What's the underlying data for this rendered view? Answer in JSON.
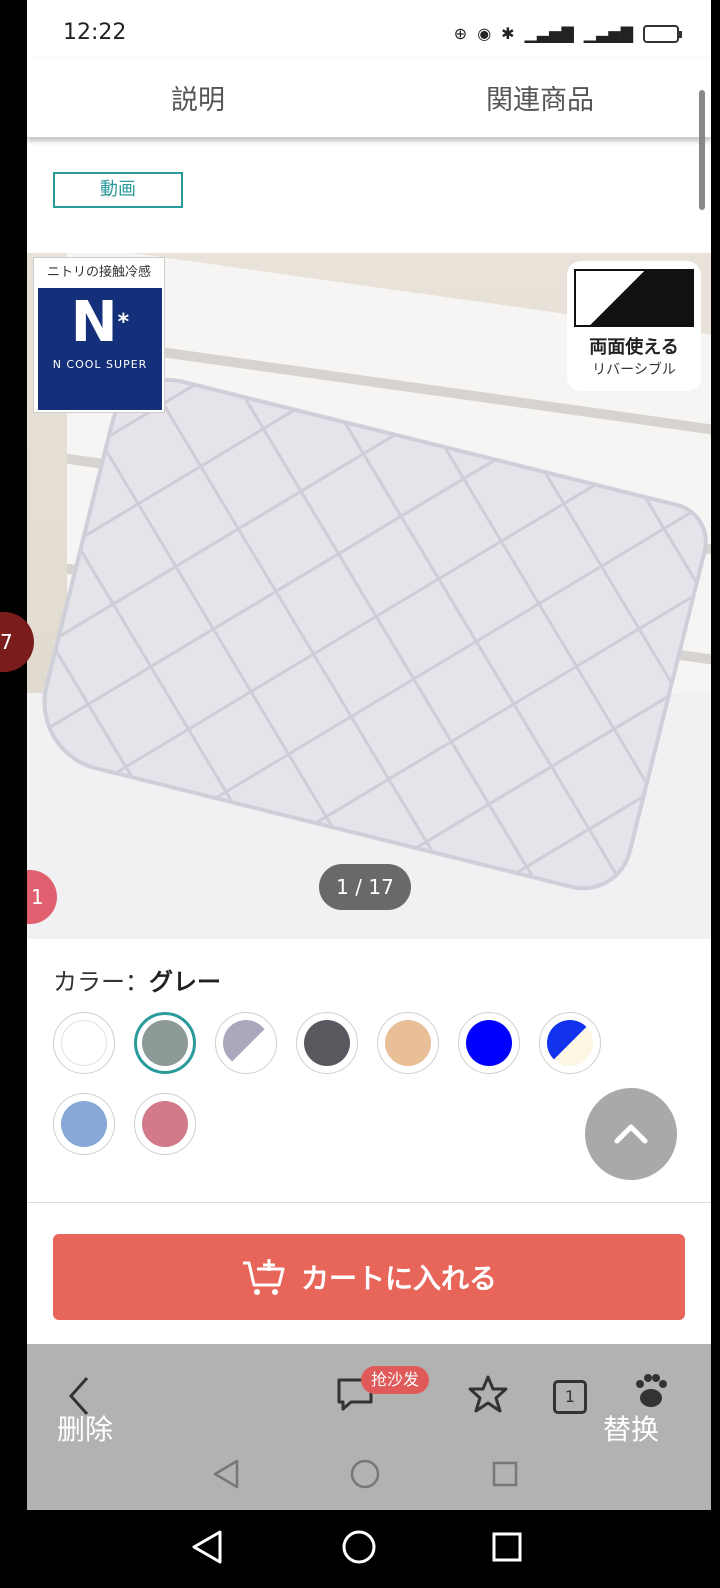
{
  "status_bar": {
    "time": "12:22"
  },
  "tabs": [
    {
      "label": "説明"
    },
    {
      "label": "関連商品"
    }
  ],
  "product": {
    "video_button": "動画",
    "image_counter": "1 / 17",
    "badges": {
      "ncool_header": "ニトリの接触冷感",
      "ncool_logo_text": "N COOL SUPER",
      "reversible_line1": "両面使える",
      "reversible_line2": "リバーシブル"
    }
  },
  "color": {
    "label": "カラー：",
    "selected": "グレー",
    "swatches": [
      {
        "name": "white",
        "color": "#ffffff"
      },
      {
        "name": "gray",
        "color": "#8e9a98",
        "selected": true
      },
      {
        "name": "lavender-white",
        "color": "#a9a8bd"
      },
      {
        "name": "dark-gray",
        "color": "#58585e"
      },
      {
        "name": "beige",
        "color": "#e9bf98"
      },
      {
        "name": "blue",
        "color": "#0000ff"
      },
      {
        "name": "blue-ivory",
        "color": "#1133ee"
      },
      {
        "name": "light-blue",
        "color": "#88a8d8"
      },
      {
        "name": "pink",
        "color": "#d27a8a"
      }
    ]
  },
  "cart": {
    "label": "カートに入れる"
  },
  "browser_toolbar": {
    "delete_label": "删除",
    "replace_label": "替换",
    "chat_badge": "抢沙发",
    "tab_count": "1"
  },
  "floating": {
    "left_badge_top": "7",
    "left_badge_bottom": "1"
  },
  "colors": {
    "accent": "#2a9a9a",
    "cart": "#e8655a"
  }
}
